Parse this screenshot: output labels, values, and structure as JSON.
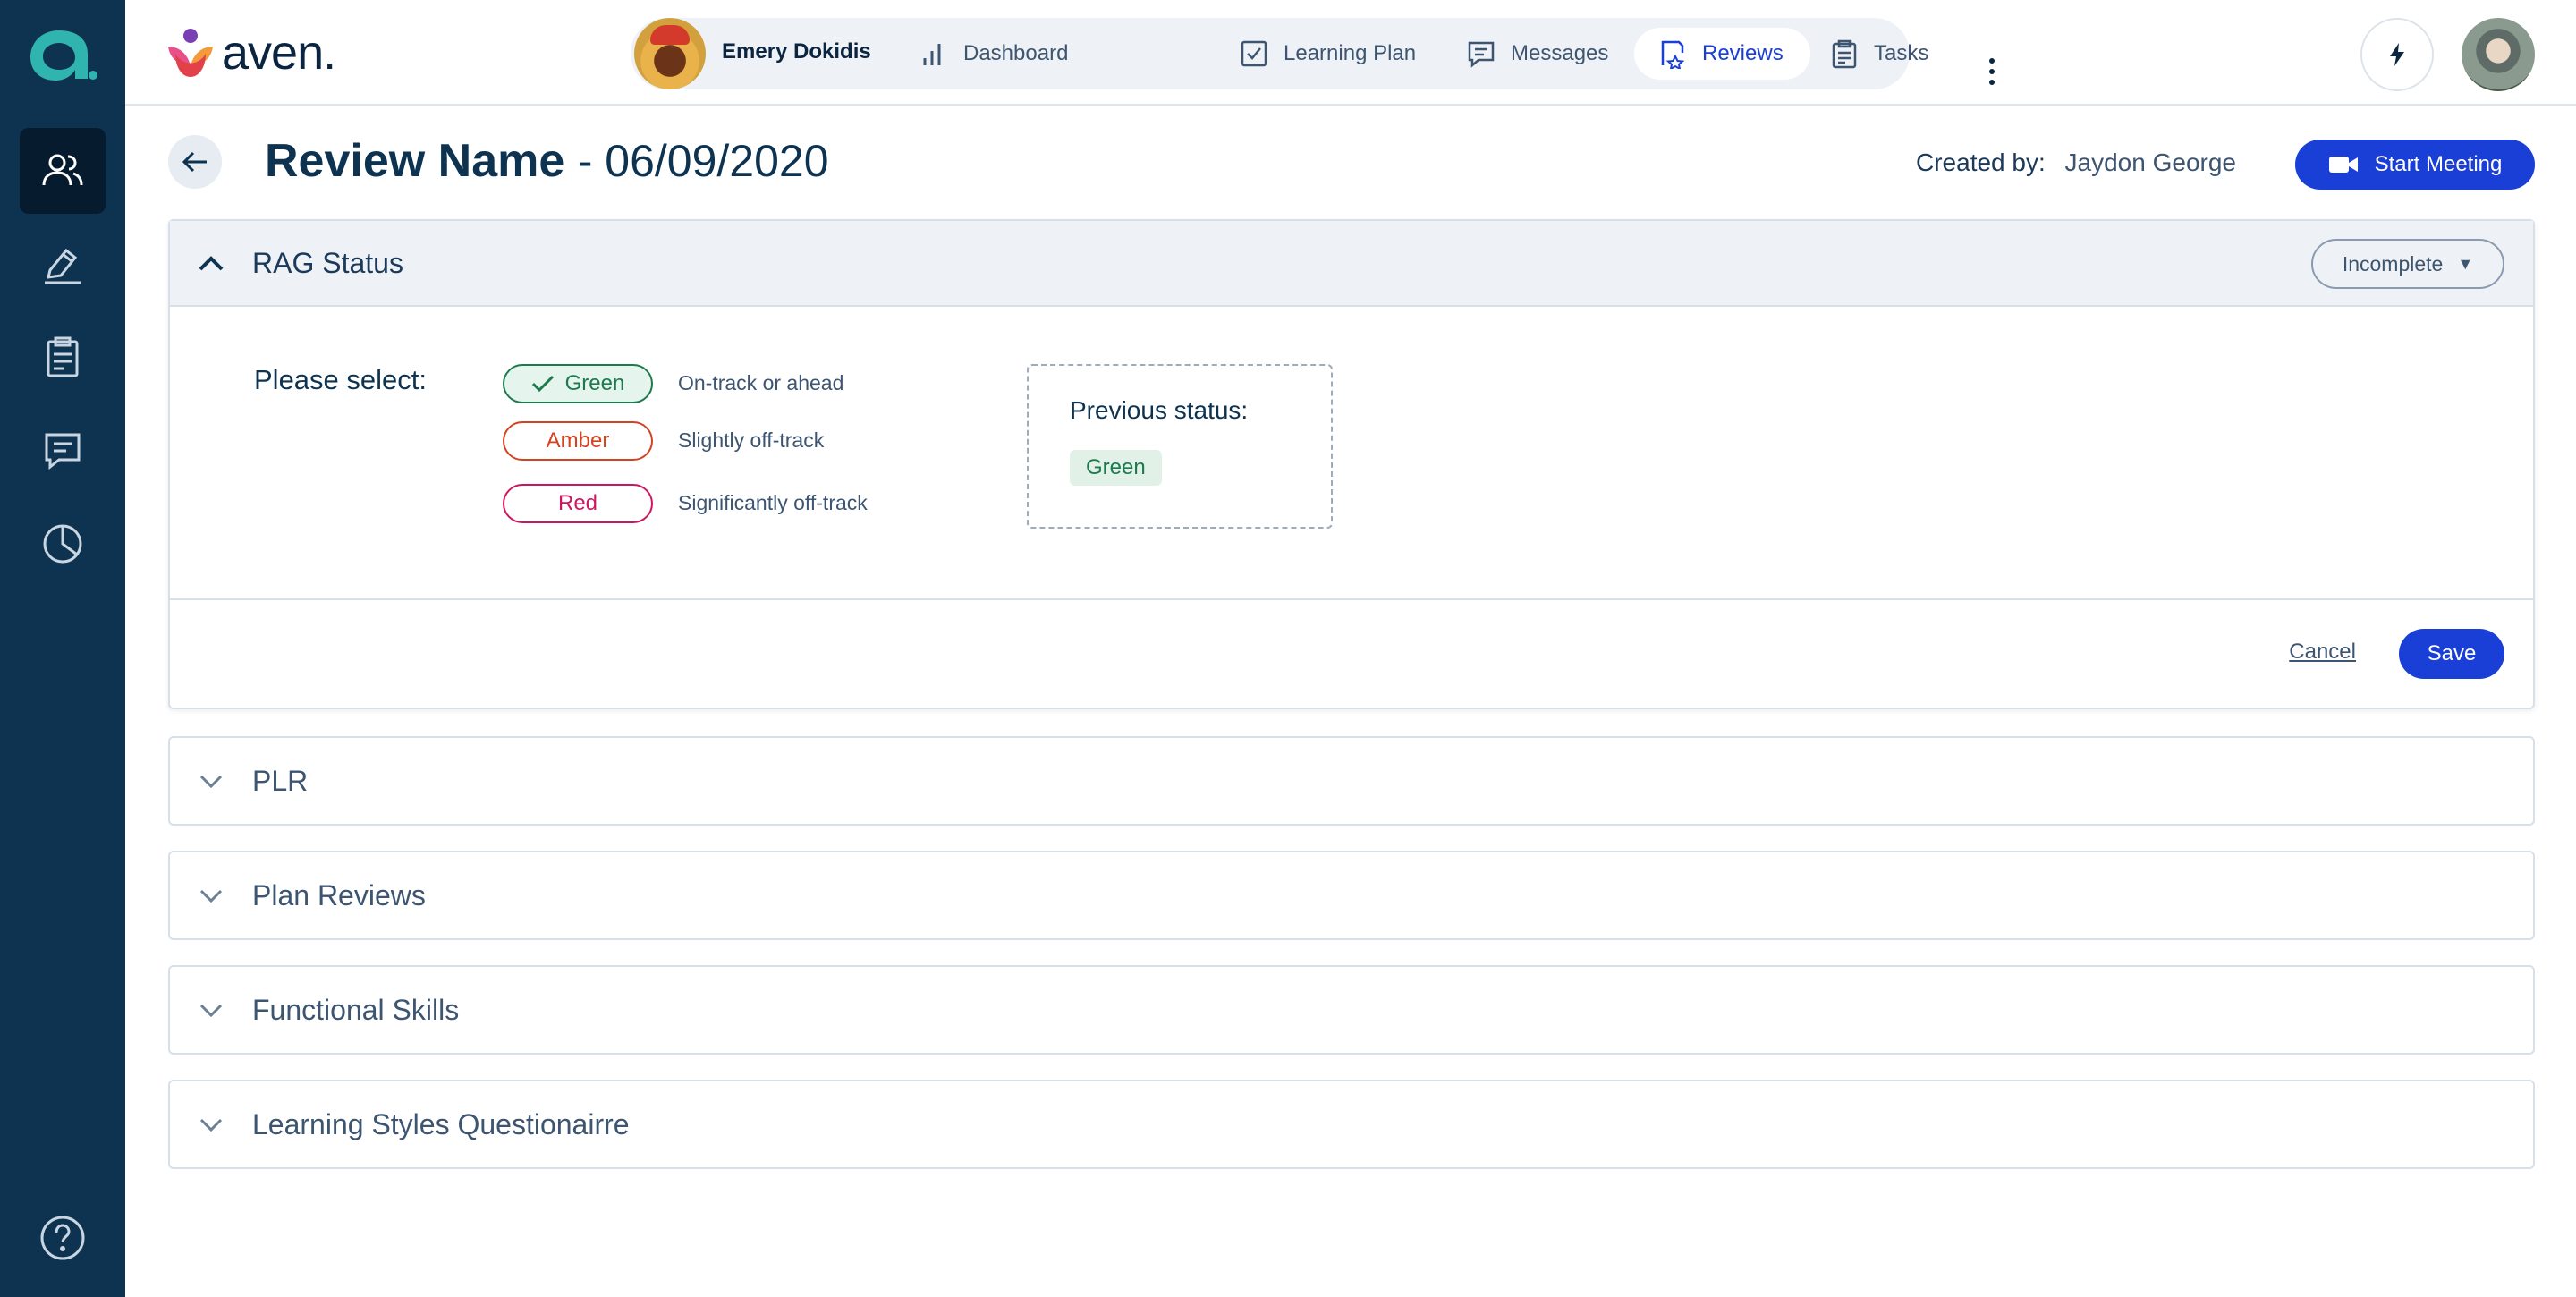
{
  "brand": {
    "name": "aven."
  },
  "colors": {
    "sidebar": "#0d3351",
    "primary": "#1a3fd6",
    "green": "#1d7a4d",
    "amber": "#d4421f",
    "red": "#cc1760"
  },
  "sidebar": {
    "items": [
      {
        "icon": "users-icon",
        "active": true
      },
      {
        "icon": "pen-icon",
        "active": false
      },
      {
        "icon": "clipboard-icon",
        "active": false
      },
      {
        "icon": "chat-icon",
        "active": false
      },
      {
        "icon": "pie-chart-icon",
        "active": false
      }
    ],
    "help_icon": "help-icon"
  },
  "nav": {
    "user_name": "Emery Dokidis",
    "items": [
      {
        "label": "Dashboard",
        "icon": "bar-chart-icon"
      },
      {
        "label": "Learning Plan",
        "icon": "checkbox-icon"
      },
      {
        "label": "Messages",
        "icon": "message-icon"
      },
      {
        "label": "Reviews",
        "icon": "review-star-icon",
        "active": true
      },
      {
        "label": "Tasks",
        "icon": "clipboard-icon"
      }
    ]
  },
  "header": {
    "title": "Review Name",
    "date": "- 06/09/2020",
    "created_by_label": "Created by:",
    "created_by_name": "Jaydon George",
    "start_meeting": "Start Meeting"
  },
  "rag": {
    "title": "RAG Status",
    "status": "Incomplete",
    "please_select": "Please select:",
    "options": [
      {
        "label": "Green",
        "desc": "On-track or ahead",
        "selected": true
      },
      {
        "label": "Amber",
        "desc": "Slightly off-track",
        "selected": false
      },
      {
        "label": "Red",
        "desc": "Significantly off-track",
        "selected": false
      }
    ],
    "previous_label": "Previous status:",
    "previous_value": "Green",
    "cancel": "Cancel",
    "save": "Save"
  },
  "sections": [
    {
      "title": "PLR"
    },
    {
      "title": "Plan Reviews"
    },
    {
      "title": "Functional Skills"
    },
    {
      "title": "Learning Styles Questionairre"
    }
  ]
}
